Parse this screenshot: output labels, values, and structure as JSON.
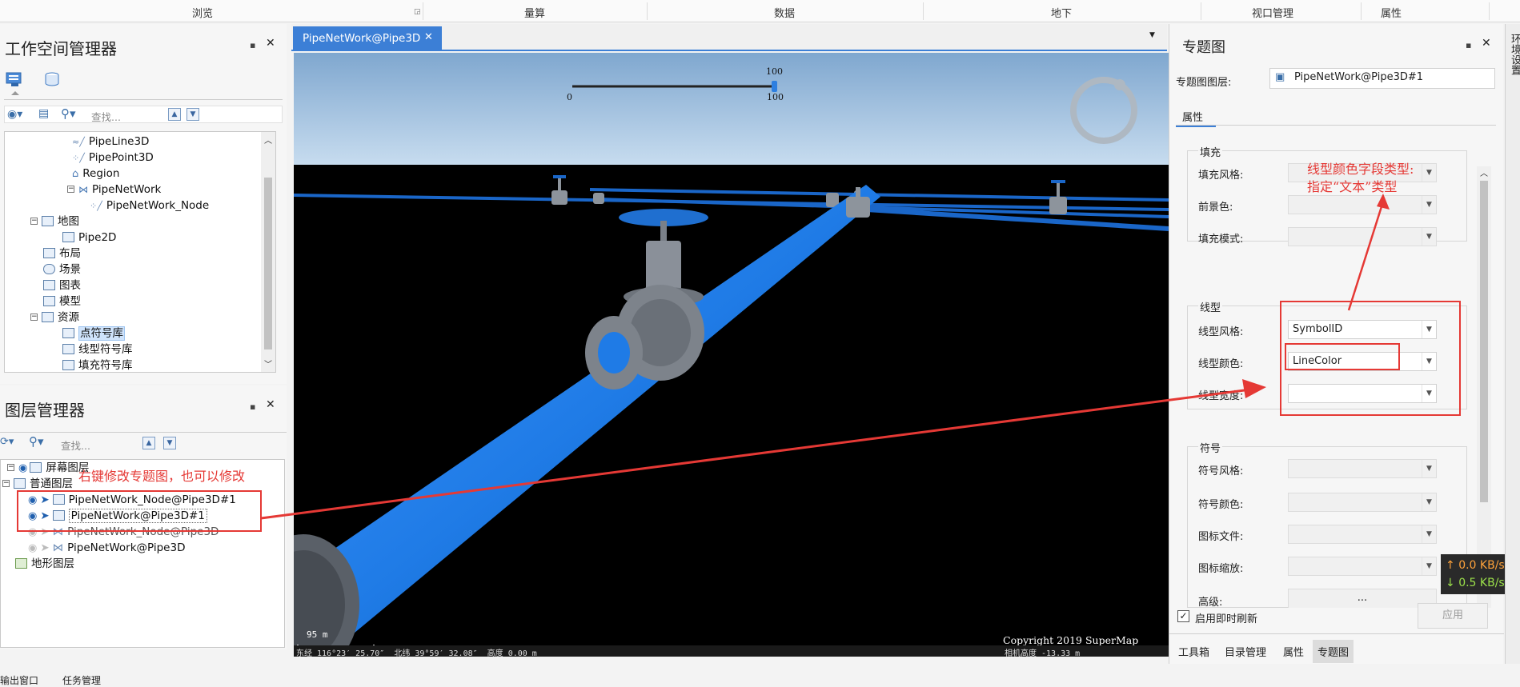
{
  "ribbon": {
    "tabs": [
      "浏览",
      "量算",
      "数据",
      "地下",
      "视口管理",
      "属性"
    ]
  },
  "workspace": {
    "title": "工作空间管理器",
    "search_placeholder": "查找...",
    "tree": [
      {
        "label": "PipeLine3D",
        "icon": "line-dataset-icon"
      },
      {
        "label": "PipePoint3D",
        "icon": "point-dataset-icon"
      },
      {
        "label": "Region",
        "icon": "region-dataset-icon"
      },
      {
        "label": "PipeNetWork",
        "icon": "network-dataset-icon"
      },
      {
        "label": "PipeNetWork_Node",
        "icon": "point-dataset-icon"
      },
      {
        "label": "地图",
        "icon": "maps-folder-icon"
      },
      {
        "label": "Pipe2D",
        "icon": "map-icon"
      },
      {
        "label": "布局",
        "icon": "layouts-folder-icon"
      },
      {
        "label": "场景",
        "icon": "scenes-folder-icon"
      },
      {
        "label": "图表",
        "icon": "charts-folder-icon"
      },
      {
        "label": "模型",
        "icon": "models-folder-icon"
      },
      {
        "label": "资源",
        "icon": "resources-folder-icon"
      },
      {
        "label": "点符号库",
        "icon": "point-symbol-library-icon"
      },
      {
        "label": "线型符号库",
        "icon": "line-symbol-library-icon"
      },
      {
        "label": "填充符号库",
        "icon": "fill-symbol-library-icon"
      }
    ]
  },
  "layers": {
    "title": "图层管理器",
    "search_placeholder": "查找...",
    "items": [
      {
        "label": "屏幕图层"
      },
      {
        "label": "普通图层"
      },
      {
        "label": "PipeNetWork_Node@Pipe3D#1"
      },
      {
        "label": "PipeNetWork@Pipe3D#1"
      },
      {
        "label": "PipeNetWork_Node@Pipe3D"
      },
      {
        "label": "PipeNetWork@Pipe3D"
      },
      {
        "label": "地形图层"
      }
    ]
  },
  "scene": {
    "tab_label": "PipeNetWork@Pipe3D",
    "slider": {
      "min": "0",
      "max": "100",
      "value": "100",
      "value_fraction": 1.0
    },
    "scale_label": "95 m",
    "copyright": "Copyright 2019 SuperMap",
    "status_coords": "东经 116°23′ 25.70″  北纬 39°59′ 32.08″  高度 0.00 m",
    "status_height": "相机高度 -13.33 m"
  },
  "thematic": {
    "title": "专题图",
    "layer_label": "专题图图层:",
    "layer_value": "PipeNetWork@Pipe3D#1",
    "properties_tab": "属性",
    "fill_group": "填充",
    "fill_style": "填充风格:",
    "foreground_color": "前景色:",
    "fill_mode": "填充模式:",
    "line_group": "线型",
    "line_style": "线型风格:",
    "line_style_value": "SymbolID",
    "line_color": "线型颜色:",
    "line_color_value": "LineColor",
    "line_width": "线型宽度:",
    "symbol_group": "符号",
    "symbol_style": "符号风格:",
    "symbol_color": "符号颜色:",
    "icon_file": "图标文件:",
    "icon_scale": "图标缩放:",
    "advanced": "高级:",
    "advanced_btn": "...",
    "realtime_refresh": "启用即时刷新",
    "realtime_checked": true,
    "apply": "应用",
    "bottom_tabs": [
      "工具箱",
      "目录管理",
      "属性",
      "专题图"
    ],
    "side_tab": "环境设置"
  },
  "net_speed": {
    "up": "0.0 KB/s",
    "down": "0.5 KB/s"
  },
  "bottom_tabs": [
    "输出窗口",
    "任务管理"
  ],
  "annotations": {
    "right_note_1": "线型颜色字段类型:",
    "right_note_2": "指定“文本”类型",
    "left_note": "右键修改专题图，也可以修改"
  },
  "colors": {
    "accent": "#1e6fd9",
    "pipe": "#1f7be6",
    "annotation": "#e53935",
    "sky_top": "#7fa7cf",
    "sky_bottom": "#c7dcef"
  }
}
